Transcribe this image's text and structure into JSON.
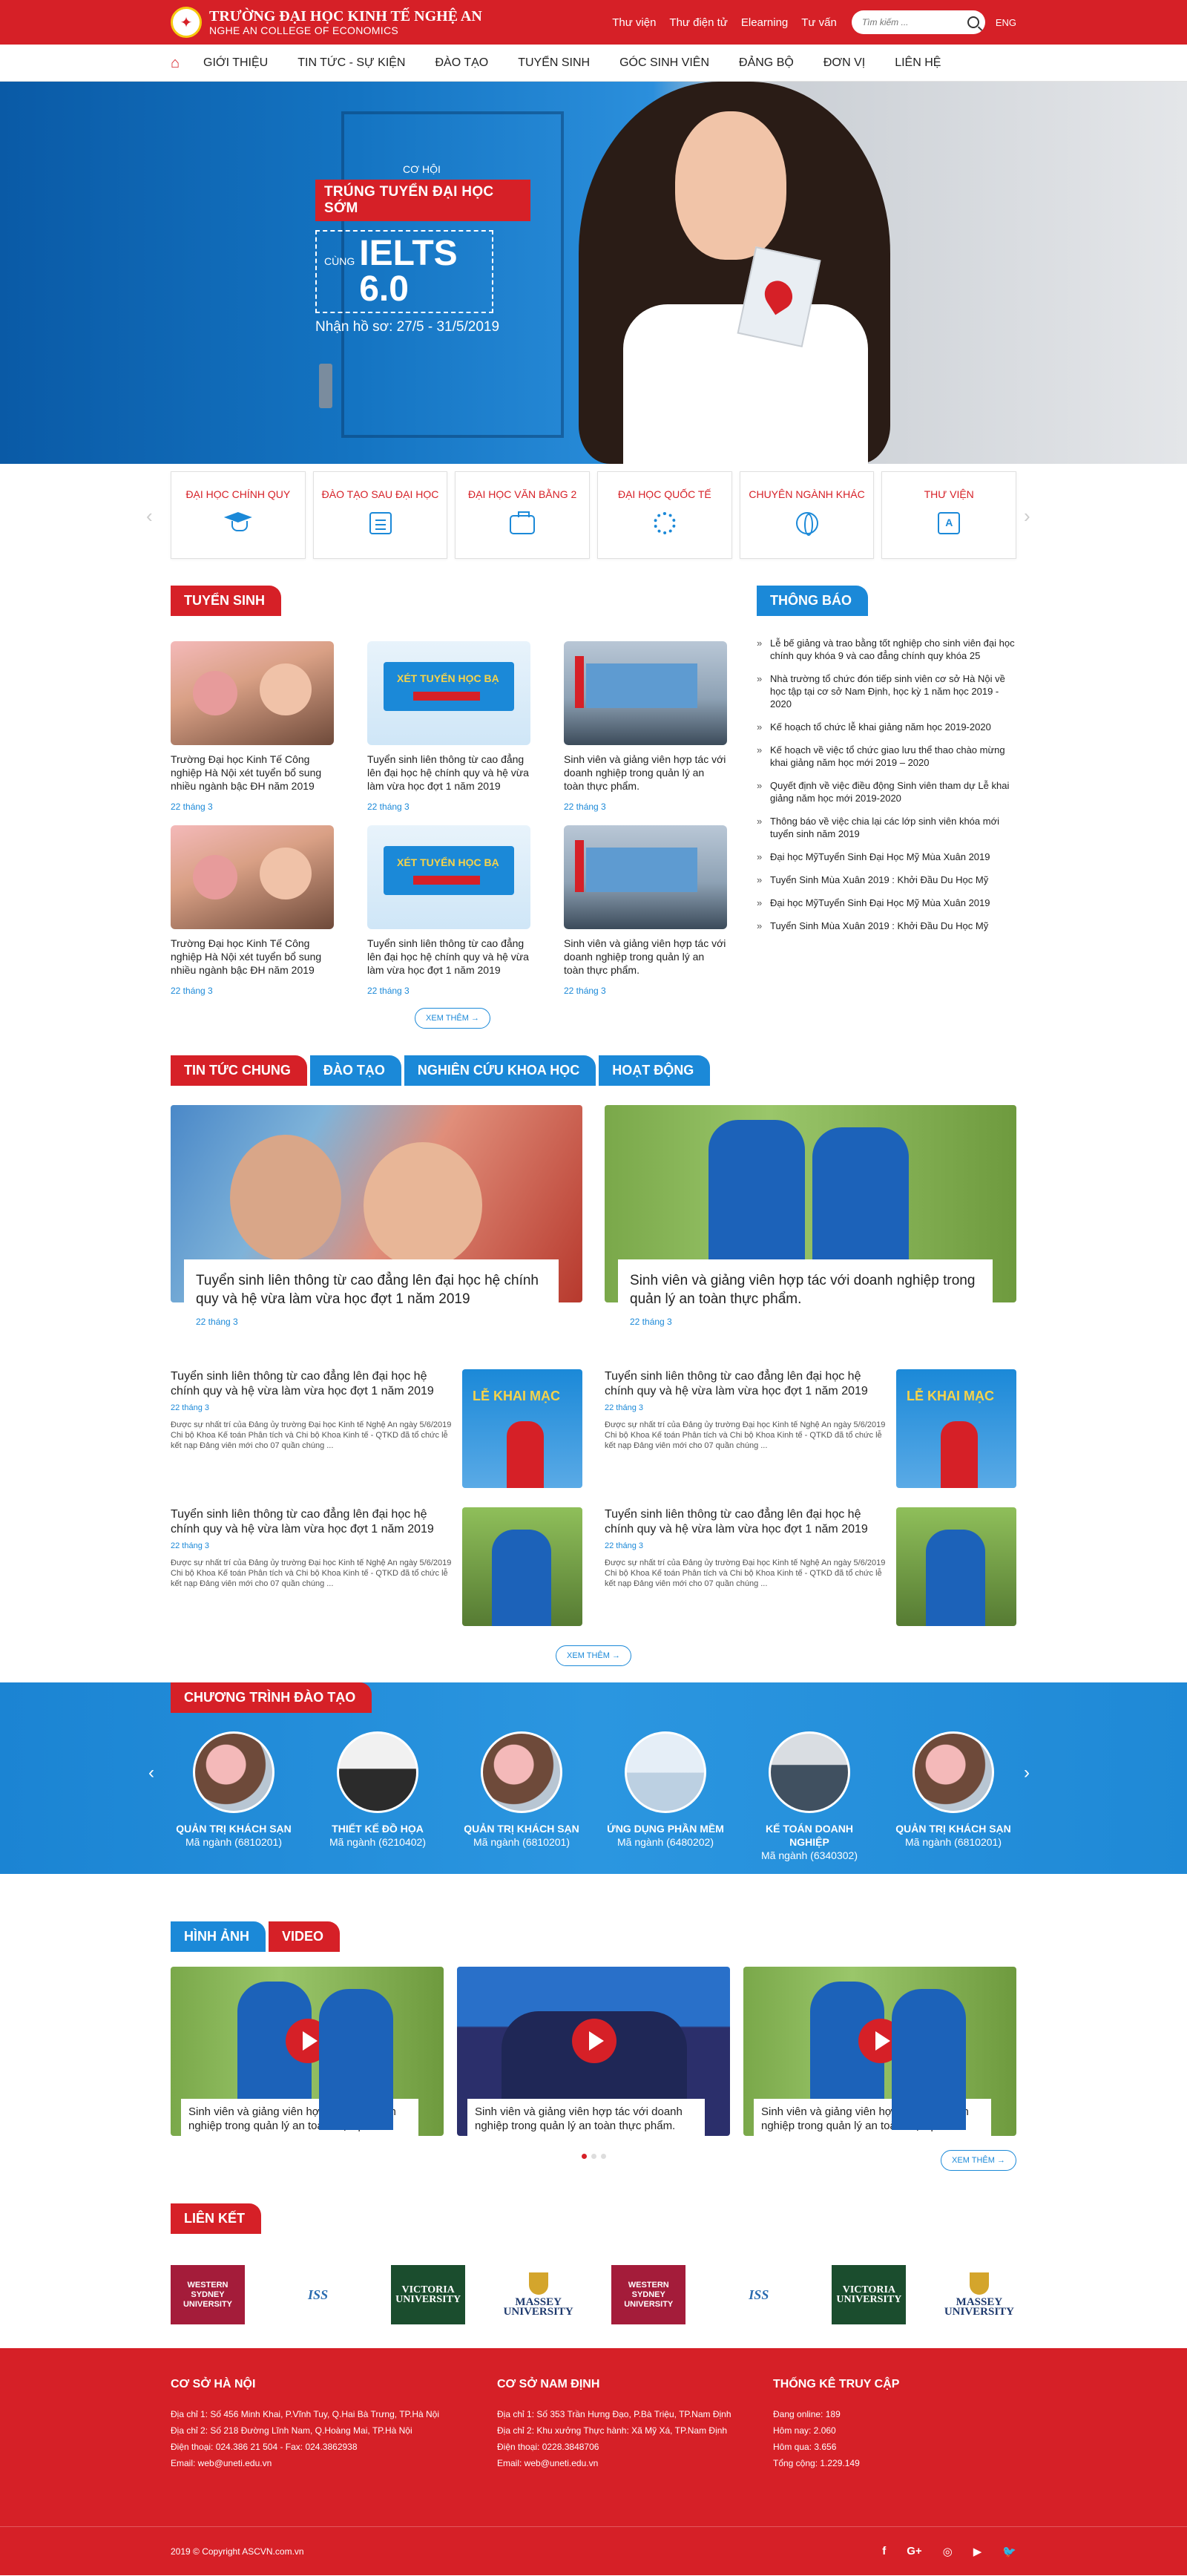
{
  "header": {
    "school_name": "TRƯỜNG ĐẠI HỌC KINH TẾ NGHỆ AN",
    "school_name_en": "NGHE AN COLLEGE OF ECONOMICS",
    "top_links": [
      "Thư viện",
      "Thư điện tử",
      "Elearning",
      "Tư vấn"
    ],
    "search_placeholder": "Tìm kiếm ...",
    "lang": "ENG"
  },
  "nav": [
    "GIỚI THIỆU",
    "TIN TỨC - SỰ KIỆN",
    "ĐÀO TẠO",
    "TUYỂN SINH",
    "GÓC SINH VIÊN",
    "ĐẢNG BỘ",
    "ĐƠN VỊ",
    "LIÊN HỆ"
  ],
  "hero": {
    "gift_label": "CƠ HỘI",
    "ribbon": "TRÚNG TUYỂN ĐẠI HỌC SỚM",
    "prefix": "CÙNG",
    "score": "IELTS 6.0",
    "dates": "Nhận hồ sơ: 27/5 - 31/5/2019"
  },
  "categories": [
    "ĐẠI HỌC CHÍNH QUY",
    "ĐÀO TẠO SAU ĐẠI HỌC",
    "ĐẠI HỌC VĂN BẰNG 2",
    "ĐẠI HỌC QUỐC TẾ",
    "CHUYÊN NGÀNH KHÁC",
    "THƯ VIỆN"
  ],
  "admissions": {
    "title": "TUYỂN SINH",
    "more": "XEM THÊM",
    "cards": [
      {
        "caption": "Trường Đại học Kinh Tế Công nghiệp Hà Nội xét tuyển bổ sung nhiều ngành bậc ĐH năm 2019",
        "date": "22 tháng 3"
      },
      {
        "caption": "Tuyển sinh liên thông từ cao đẳng lên đại học hệ chính quy và hệ vừa làm vừa học đợt 1 năm 2019",
        "date": "22 tháng 3"
      },
      {
        "caption": "Sinh viên và giảng viên hợp tác với doanh nghiệp trong quản lý an toàn thực phẩm.",
        "date": "22 tháng 3"
      },
      {
        "caption": "Trường Đại học Kinh Tế Công nghiệp Hà Nội xét tuyển bổ sung nhiều ngành bậc ĐH năm 2019",
        "date": "22 tháng 3"
      },
      {
        "caption": "Tuyển sinh liên thông từ cao đẳng lên đại học hệ chính quy và hệ vừa làm vừa học đợt 1 năm 2019",
        "date": "22 tháng 3"
      },
      {
        "caption": "Sinh viên và giảng viên hợp tác với doanh nghiệp trong quản lý an toàn thực phẩm.",
        "date": "22 tháng 3"
      }
    ]
  },
  "notices": {
    "title": "THÔNG BÁO",
    "items": [
      "Lễ bế giảng và trao bằng tốt nghiệp cho sinh viên đại học chính quy khóa 9 và cao đẳng chính quy khóa 25",
      "Nhà trường tổ chức đón tiếp sinh viên cơ sở Hà Nội về học tập tại cơ sở Nam Định, học kỳ 1 năm học 2019 - 2020",
      "Kế hoạch tổ chức lễ khai giảng năm học 2019-2020",
      "Kế hoạch về việc tổ chức giao lưu thể thao chào mừng khai giảng năm học mới 2019 – 2020",
      "Quyết định về việc điều động Sinh viên tham dự Lễ khai giảng năm học mới 2019-2020",
      "Thông báo về việc chia lại các lớp sinh viên khóa mới tuyển sinh năm 2019",
      "Đại học MỹTuyển Sinh Đại Học Mỹ Mùa Xuân 2019",
      "Tuyển Sinh Mùa Xuân 2019 : Khởi Đầu Du Học Mỹ",
      "Đại học MỹTuyển Sinh Đại Học Mỹ Mùa Xuân 2019",
      "Tuyển Sinh Mùa Xuân 2019 : Khởi Đầu Du Học Mỹ"
    ]
  },
  "news": {
    "tabs": [
      "TIN TỨC CHUNG",
      "ĐÀO TẠO",
      "NGHIÊN CỨU KHOA HỌC",
      "HOẠT ĐỘNG"
    ],
    "featured": [
      {
        "title": "Tuyển sinh liên thông từ cao đẳng lên đại học hệ chính quy và hệ vừa làm vừa học đợt 1 năm 2019",
        "date": "22 tháng 3"
      },
      {
        "title": "Sinh viên và giảng viên hợp tác với doanh nghiệp trong quản lý an toàn thực phẩm.",
        "date": "22 tháng 3"
      }
    ],
    "list": [
      {
        "title": "Tuyển sinh liên thông từ cao đẳng lên đại học hệ chính quy và hệ vừa làm vừa học đợt 1 năm 2019",
        "date": "22 tháng 3",
        "excerpt": "Được sự nhất trí của Đảng ủy trường Đại học Kinh tế Nghệ An ngày 5/6/2019 Chi bộ Khoa Kế toán Phân tích và Chi bộ Khoa Kinh tế - QTKD đã tổ chức lễ kết nạp Đảng viên mới cho 07 quần chúng ..."
      },
      {
        "title": "Tuyển sinh liên thông từ cao đẳng lên đại học hệ chính quy và hệ vừa làm vừa học đợt 1 năm 2019",
        "date": "22 tháng 3",
        "excerpt": "Được sự nhất trí của Đảng ủy trường Đại học Kinh tế Nghệ An ngày 5/6/2019 Chi bộ Khoa Kế toán Phân tích và Chi bộ Khoa Kinh tế - QTKD đã tổ chức lễ kết nạp Đảng viên mới cho 07 quần chúng ..."
      },
      {
        "title": "Tuyển sinh liên thông từ cao đẳng lên đại học hệ chính quy và hệ vừa làm vừa học đợt 1 năm 2019",
        "date": "22 tháng 3",
        "excerpt": "Được sự nhất trí của Đảng ủy trường Đại học Kinh tế Nghệ An ngày 5/6/2019 Chi bộ Khoa Kế toán Phân tích và Chi bộ Khoa Kinh tế - QTKD đã tổ chức lễ kết nạp Đảng viên mới cho 07 quần chúng ..."
      },
      {
        "title": "Tuyển sinh liên thông từ cao đẳng lên đại học hệ chính quy và hệ vừa làm vừa học đợt 1 năm 2019",
        "date": "22 tháng 3",
        "excerpt": "Được sự nhất trí của Đảng ủy trường Đại học Kinh tế Nghệ An ngày 5/6/2019 Chi bộ Khoa Kế toán Phân tích và Chi bộ Khoa Kinh tế - QTKD đã tổ chức lễ kết nạp Đảng viên mới cho 07 quần chúng ..."
      }
    ],
    "more": "XEM THÊM"
  },
  "programs": {
    "title": "CHƯƠNG TRÌNH ĐÀO TẠO",
    "items": [
      {
        "name": "QUẢN TRỊ KHÁCH SẠN",
        "code": "Mã ngành (6810201)"
      },
      {
        "name": "THIẾT KẾ ĐỒ HỌA",
        "code": "Mã ngành (6210402)"
      },
      {
        "name": "QUẢN TRỊ KHÁCH SẠN",
        "code": "Mã ngành (6810201)"
      },
      {
        "name": "ỨNG DỤNG PHẦN MỀM",
        "code": "Mã ngành (6480202)"
      },
      {
        "name": "KẾ TOÁN DOANH NGHIỆP",
        "code": "Mã ngành (6340302)"
      },
      {
        "name": "QUẢN TRỊ KHÁCH SẠN",
        "code": "Mã ngành (6810201)"
      }
    ]
  },
  "media": {
    "tabs": [
      "HÌNH ẢNH",
      "VIDEO"
    ],
    "items": [
      "Sinh viên và giảng viên hợp tác với doanh nghiệp trong quản lý an toàn thực phẩm.",
      "Sinh viên và giảng viên hợp tác với doanh nghiệp trong quản lý an toàn thực phẩm.",
      "Sinh viên và giảng viên hợp tác với doanh nghiệp trong quản lý an toàn thực phẩm."
    ],
    "more": "XEM THÊM"
  },
  "links": {
    "title": "LIÊN KẾT",
    "logos": [
      "WESTERN SYDNEY UNIVERSITY",
      "ISS",
      "VICTORIA UNIVERSITY",
      "MASSEY UNIVERSITY",
      "WESTERN SYDNEY UNIVERSITY",
      "ISS",
      "VICTORIA UNIVERSITY",
      "MASSEY UNIVERSITY"
    ]
  },
  "footer": {
    "hanoi": {
      "title": "CƠ SỞ HÀ NỘI",
      "lines": [
        "Địa chỉ 1: Số 456 Minh Khai, P.Vĩnh Tuy, Q.Hai Bà Trưng, TP.Hà Nội",
        "Địa chỉ 2: Số 218 Đường Lĩnh Nam, Q.Hoàng Mai, TP.Hà Nội",
        "Điện thoại: 024.386 21 504 - Fax: 024.3862938",
        "Email: web@uneti.edu.vn"
      ]
    },
    "namdinh": {
      "title": "CƠ SỞ NAM ĐỊNH",
      "lines": [
        "Địa chỉ 1: Số 353 Trần Hưng Đạo, P.Bà Triệu, TP.Nam Định",
        "Địa chỉ 2: Khu xưởng Thực hành: Xã Mỹ Xá, TP.Nam Định",
        "Điện thoại: 0228.3848706",
        "Email: web@uneti.edu.vn"
      ]
    },
    "stats": {
      "title": "THỐNG KÊ TRUY CẬP",
      "lines": [
        "Đang online: 189",
        "Hôm nay: 2.060",
        "Hôm qua: 3.656",
        "Tổng cộng: 1.229.149"
      ]
    },
    "copyright": "2019 © Copyright  ASCVN.com.vn",
    "social": [
      "f",
      "G+",
      "◎",
      "▶",
      "🐦"
    ]
  }
}
